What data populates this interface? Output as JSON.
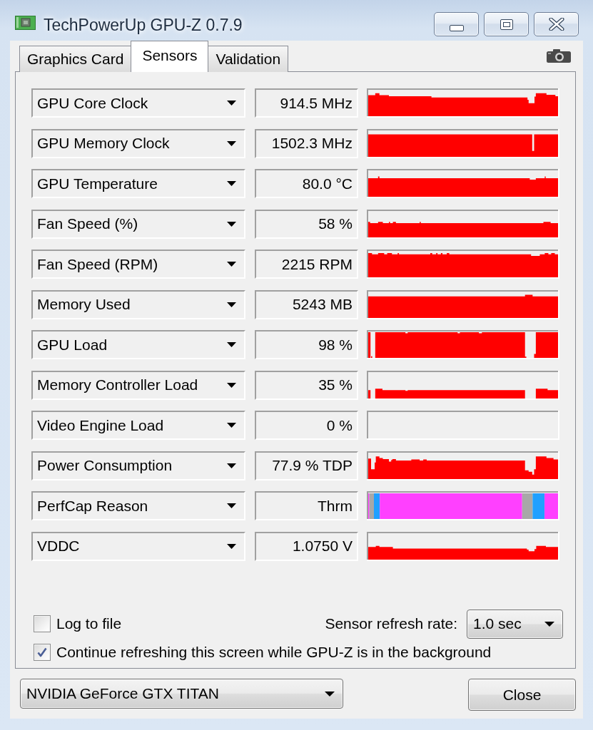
{
  "window": {
    "title": "TechPowerUp GPU-Z 0.7.9"
  },
  "tabs": [
    {
      "label": "Graphics Card",
      "selected": false
    },
    {
      "label": "Sensors",
      "selected": true
    },
    {
      "label": "Validation",
      "selected": false
    }
  ],
  "sensors": [
    {
      "name": "GPU Core Clock",
      "value": "914.5 MHz"
    },
    {
      "name": "GPU Memory Clock",
      "value": "1502.3 MHz"
    },
    {
      "name": "GPU Temperature",
      "value": "80.0 °C"
    },
    {
      "name": "Fan Speed (%)",
      "value": "58 %"
    },
    {
      "name": "Fan Speed (RPM)",
      "value": "2215 RPM"
    },
    {
      "name": "Memory Used",
      "value": "5243 MB"
    },
    {
      "name": "GPU Load",
      "value": "98 %"
    },
    {
      "name": "Memory Controller Load",
      "value": "35 %"
    },
    {
      "name": "Video Engine Load",
      "value": "0 %"
    },
    {
      "name": "Power Consumption",
      "value": "77.9 % TDP"
    },
    {
      "name": "PerfCap Reason",
      "value": "Thrm"
    },
    {
      "name": "VDDC",
      "value": "1.0750 V"
    }
  ],
  "log_to_file": {
    "label": "Log to file",
    "checked": false
  },
  "refresh_rate": {
    "label": "Sensor refresh rate:",
    "value": "1.0 sec"
  },
  "background_refresh": {
    "label": "Continue refreshing this screen while GPU-Z is in the background",
    "checked": true
  },
  "device_select": {
    "value": "NVIDIA GeForce GTX TITAN"
  },
  "buttons": [
    "Close"
  ]
}
